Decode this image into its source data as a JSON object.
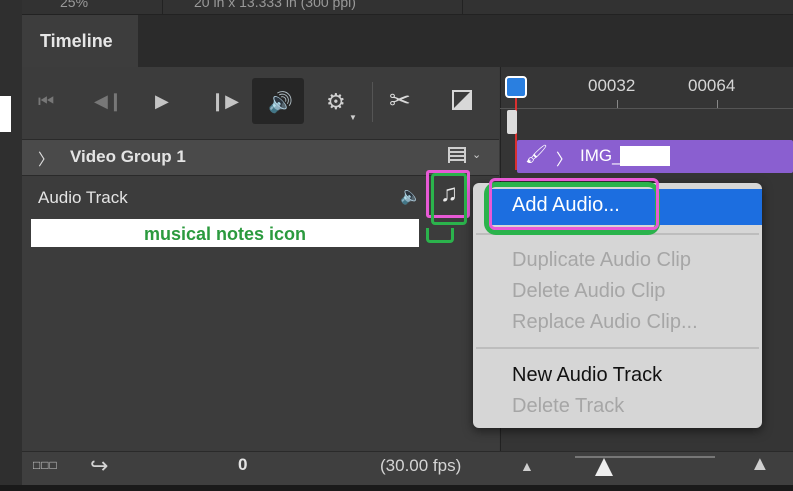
{
  "top_band": {
    "zoom": "25%",
    "dimensions": "20 in x 13.333 in (300 ppi)"
  },
  "panel": {
    "title": "Timeline"
  },
  "transport": {
    "goto_first": "⏮",
    "prev_frame": "◀❙",
    "play": "▶",
    "next_frame": "❙▶",
    "audio": "🔊",
    "settings": "⚙",
    "settings_caret": "▼",
    "split": "✂"
  },
  "ruler": {
    "labels": [
      "00032",
      "00064"
    ]
  },
  "video_group": {
    "chevron": "〉",
    "label": "Video Group 1",
    "menu_caret": "⌄"
  },
  "clip": {
    "brush": "🖌",
    "chevron": "〉",
    "name": "IMG_     .jpg"
  },
  "audio_track": {
    "label": "Audio Track",
    "speaker": "🔈",
    "note": "♫"
  },
  "annotation": {
    "text": "musical notes icon"
  },
  "context_menu": {
    "items": [
      "Add Audio...",
      "Duplicate Audio Clip",
      "Delete Audio Clip",
      "Replace Audio Clip...",
      "New Audio Track",
      "Delete Track"
    ],
    "enabled": [
      true,
      false,
      false,
      false,
      true,
      false
    ],
    "highlight_color": "#1c6ee0"
  },
  "bottom_bar": {
    "frames_icon": "□□□",
    "share_icon": "↪",
    "frame": "0",
    "fps": "(30.00 fps)",
    "zoom_out": "▲",
    "zoom_in": "▲"
  },
  "colors": {
    "clip": "#8a5fd0",
    "annotation_green": "#2bb34c",
    "annotation_pink": "#e85ad6",
    "playhead": "#d93030"
  }
}
